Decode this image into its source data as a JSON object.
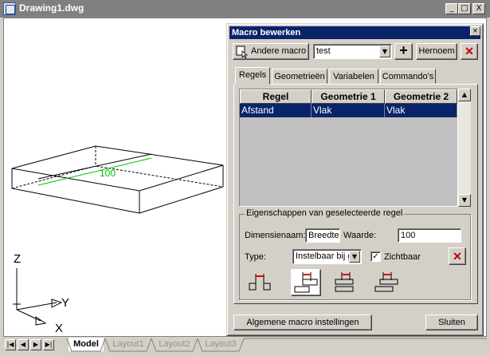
{
  "window": {
    "title": "Drawing1.dwg",
    "controls": {
      "minimize": "_",
      "maximize": "□",
      "close": "X"
    }
  },
  "drawing": {
    "dimension_text": "100",
    "ucs": {
      "z": "Z",
      "y": "Y",
      "x": "X"
    }
  },
  "layout_tabs": {
    "nav": [
      "|◀",
      "◀",
      "▶",
      "▶|"
    ],
    "tabs": [
      {
        "label": "Model",
        "active": true
      },
      {
        "label": "Layout1",
        "active": false
      },
      {
        "label": "Layout2",
        "active": false
      },
      {
        "label": "Layout3",
        "active": false
      }
    ]
  },
  "dialog": {
    "title": "Macro bewerken",
    "close": "×",
    "toolbar": {
      "andere_macro_label": "Andere macro",
      "macro_value": "test",
      "add_symbol": "+",
      "hernoem_label": "Hernoem",
      "delete_symbol": "✕"
    },
    "tabs": [
      "Regels",
      "Geometrieën",
      "Variabelen",
      "Commando's"
    ],
    "active_tab": "Regels",
    "grid": {
      "columns": [
        "Regel",
        "Geometrie 1",
        "Geometrie 2"
      ],
      "rows": [
        {
          "regel": "Afstand",
          "geometrie1": "Vlak",
          "geometrie2": "Vlak",
          "selected": true
        }
      ],
      "scroll_up": "▲",
      "scroll_down": "▼"
    },
    "properties": {
      "group_title": "Eigenschappen van geselecteerde regel",
      "dimensienaam_label": "Dimensienaam:",
      "dimensienaam_value": "Breedte",
      "waarde_label": "Waarde:",
      "waarde_value": "100",
      "type_label": "Type:",
      "type_value": "Instelbaar bij g",
      "zichtbaar_label": "Zichtbaar",
      "zichtbaar_checked": true,
      "check_mark": "✓"
    },
    "footer": {
      "algemene_label": "Algemene macro instellingen",
      "sluiten_label": "Sluiten"
    }
  },
  "colors": {
    "accent": "#0a246a",
    "dimension": "#00c000",
    "delete": "#c00000",
    "arrow": "#e00000"
  }
}
